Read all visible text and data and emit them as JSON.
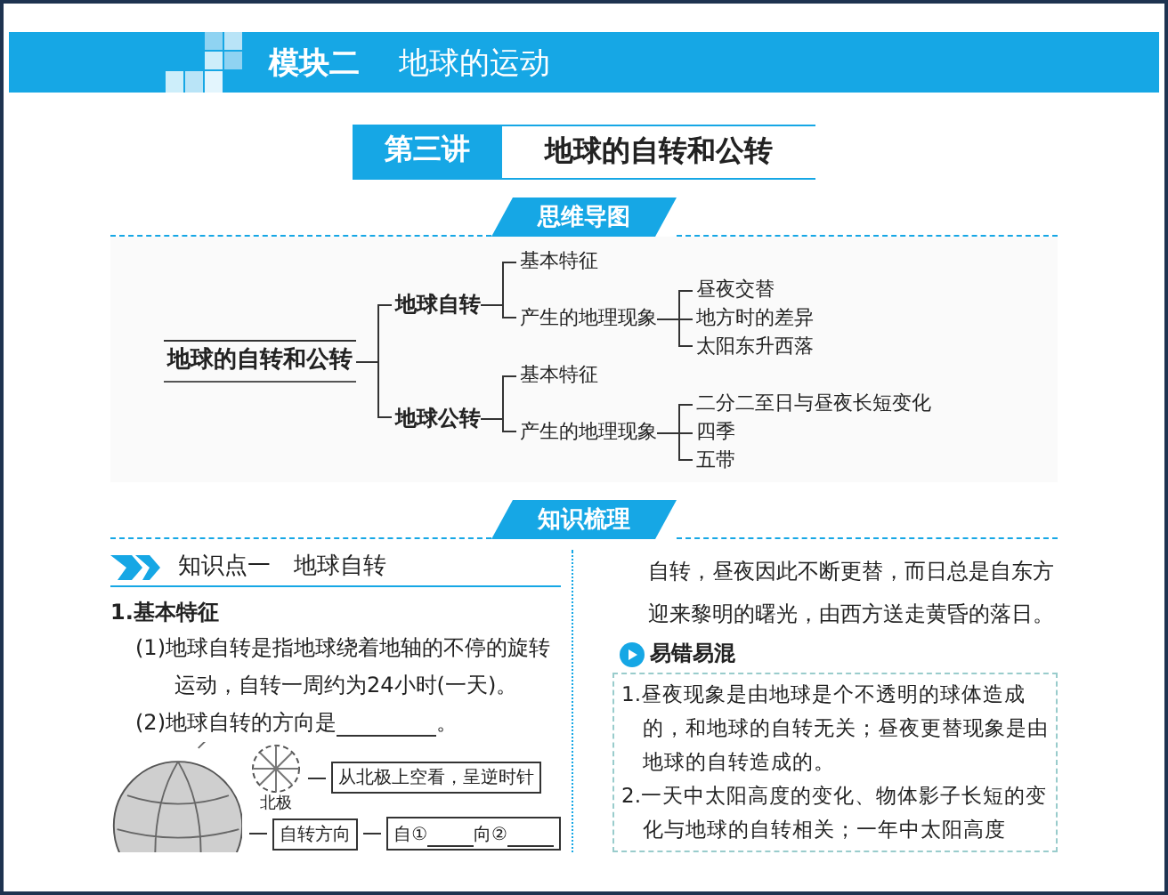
{
  "module_bar": {
    "label": "模块二",
    "title": "地球的运动"
  },
  "lecture": {
    "number": "第三讲",
    "title": "地球的自转和公转"
  },
  "mind_map": {
    "heading": "思维导图",
    "root": {
      "label": "地球的自转和公转",
      "children": [
        {
          "label": "地球自转",
          "children": [
            {
              "label": "基本特征"
            },
            {
              "label": "产生的地理现象",
              "children": [
                {
                  "label": "昼夜交替"
                },
                {
                  "label": "地方时的差异"
                },
                {
                  "label": "太阳东升西落"
                }
              ]
            }
          ]
        },
        {
          "label": "地球公转",
          "children": [
            {
              "label": "基本特征"
            },
            {
              "label": "产生的地理现象",
              "children": [
                {
                  "label": "二分二至日与昼夜长短变化"
                },
                {
                  "label": "四季"
                },
                {
                  "label": "五带"
                }
              ]
            }
          ]
        }
      ]
    }
  },
  "knowledge": {
    "heading": "知识梳理",
    "point_heading": "知识点一　地球自转",
    "section": "1.基本特征",
    "items": [
      {
        "text": "(1)地球自转是指地球绕着地轴的不停的旋转运动，自转一周约为24小时(一天)。",
        "blank": false
      },
      {
        "text": "(2)地球自转的方向是",
        "blank": true,
        "after": "。"
      }
    ],
    "figure": {
      "pole_label": "北极",
      "view_note": "从北极上空看，呈逆时针",
      "direction_label": "自转方向",
      "fill_in": [
        "自①",
        "向②"
      ]
    },
    "paragraph": "自转，昼夜因此不断更替，而日总是自东方迎来黎明的曙光，由西方送走黄昏的落日。",
    "tips": {
      "heading": "易错易混",
      "items": [
        "1.昼夜现象是由地球是个不透明的球体造成的，和地球的自转无关；昼夜更替现象是由地球的自转造成的。",
        "2.一天中太阳高度的变化、物体影子长短的变化与地球的自转相关；一年中太阳高度"
      ]
    }
  }
}
